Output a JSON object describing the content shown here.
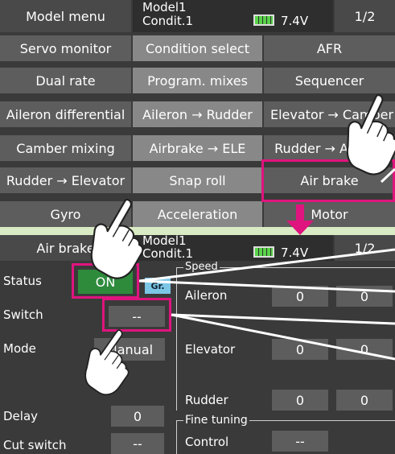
{
  "top_screen": {
    "menu_title": "Model menu",
    "model_name": "Model1",
    "condition": "Condit.1",
    "voltage": "7.4V",
    "page": "1/2",
    "rows": [
      [
        "Servo monitor",
        "Condition select",
        "AFR"
      ],
      [
        "Dual rate",
        "Program. mixes",
        "Sequencer"
      ],
      [
        "Aileron differential",
        "Aileron → Rudder",
        "Elevator → Camber"
      ],
      [
        "Camber mixing",
        "Airbrake → ELE",
        "Rudder → Aileron"
      ],
      [
        "Rudder → Elevator",
        "Snap roll",
        "Air brake"
      ],
      [
        "Gyro",
        "Acceleration",
        "Motor"
      ]
    ]
  },
  "bottom_screen": {
    "title": "Air brake",
    "model_name": "Model1",
    "condition": "Condit.1",
    "voltage": "7.4V",
    "page": "1/2",
    "status_label": "Status",
    "status_value": "ON",
    "group_badge": "Gr.",
    "switch_label": "Switch",
    "switch_value": "--",
    "mode_label": "Mode",
    "mode_value": "Manual",
    "delay_label": "Delay",
    "delay_value": "0",
    "cut_switch_label": "Cut switch",
    "cut_switch_value": "--",
    "speed_group_label": "Speed",
    "rows": [
      {
        "label": "Aileron",
        "v1": "0",
        "v2": "0"
      },
      {
        "label": "Elevator",
        "v1": "0",
        "v2": "0"
      },
      {
        "label": "Rudder",
        "v1": "0",
        "v2": "0"
      }
    ],
    "fine_tuning_label": "Fine tuning",
    "control_label": "Control",
    "control_value": "--"
  },
  "colors": {
    "accent": "#e0147e",
    "on_green": "#2e8b3c",
    "background": "#d9ebc4"
  }
}
